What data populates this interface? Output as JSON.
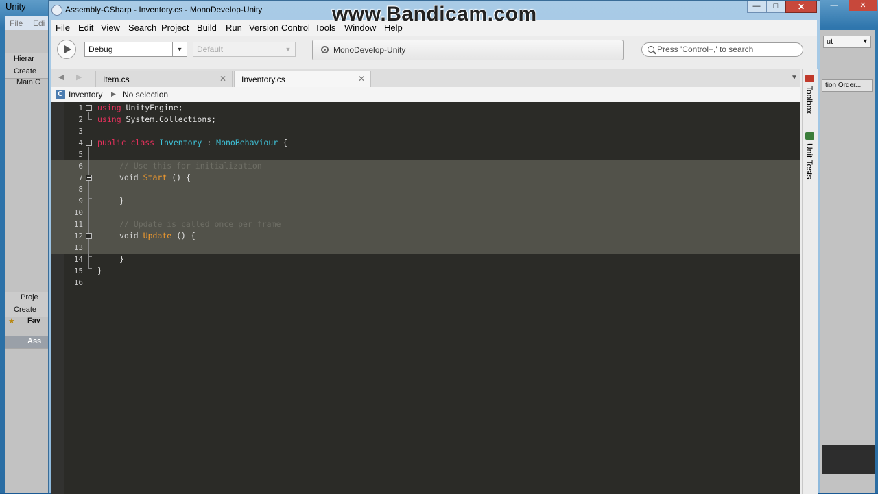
{
  "watermark": "www.Bandicam.com",
  "unity": {
    "title": "Unity",
    "menu": [
      "File",
      "Edi"
    ],
    "hierarchy_tab": "Hierar",
    "create_label": "Create",
    "hierarchy_item": "Main C",
    "project_tab": "Proje",
    "favorites_label": "Fav",
    "assets_label": "Ass",
    "right_dropdown": "ut",
    "right_button": "tion Order...",
    "win_controls": [
      "—",
      "✕"
    ]
  },
  "window": {
    "title": "Assembly-CSharp - Inventory.cs - MonoDevelop-Unity",
    "controls": {
      "minimize": "—",
      "maximize": "□",
      "close": "✕"
    }
  },
  "menu": [
    "File",
    "Edit",
    "View",
    "Search",
    "Project",
    "Build",
    "Run",
    "Version Control",
    "Tools",
    "Window",
    "Help"
  ],
  "toolbar": {
    "configuration": "Debug",
    "target": "Default",
    "status": "MonoDevelop-Unity",
    "search_placeholder": "Press 'Control+,' to search"
  },
  "tabs": [
    {
      "label": "Item.cs",
      "active": false
    },
    {
      "label": "Inventory.cs",
      "active": true
    }
  ],
  "pathbar": {
    "class_icon": "C",
    "class_name": "Inventory",
    "member": "No selection"
  },
  "editor": {
    "line_numbers": [
      "1",
      "2",
      "3",
      "4",
      "5",
      "6",
      "7",
      "8",
      "9",
      "10",
      "11",
      "12",
      "13",
      "14",
      "15",
      "16"
    ],
    "tokens": {
      "l1_kw": "using",
      "l1_rest": " UnityEngine;",
      "l2_kw": "using",
      "l2_rest": " System.Collections;",
      "l4_kw1": "public",
      "l4_kw2": "class",
      "l4_cls": "Inventory",
      "l4_colon": " : ",
      "l4_base": "MonoBehaviour",
      "l4_brace": " {",
      "l6_comment": "// Use this for initialization",
      "l7_void": "void",
      "l7_fn": "Start",
      "l7_rest": " () {",
      "l9_brace": "}",
      "l11_comment": "// Update is called once per frame",
      "l12_void": "void",
      "l12_fn": "Update",
      "l12_rest": " () {",
      "l14_brace": "}",
      "l15_brace": "}"
    }
  },
  "dock": [
    "Toolbox",
    "Unit Tests"
  ],
  "colors": {
    "keyword": "#e8305c",
    "type": "#3fc2d8",
    "method": "#f09a2e",
    "comment": "#6f6f66",
    "editor_bg": "#2b2b27",
    "selection": "#52524a"
  }
}
